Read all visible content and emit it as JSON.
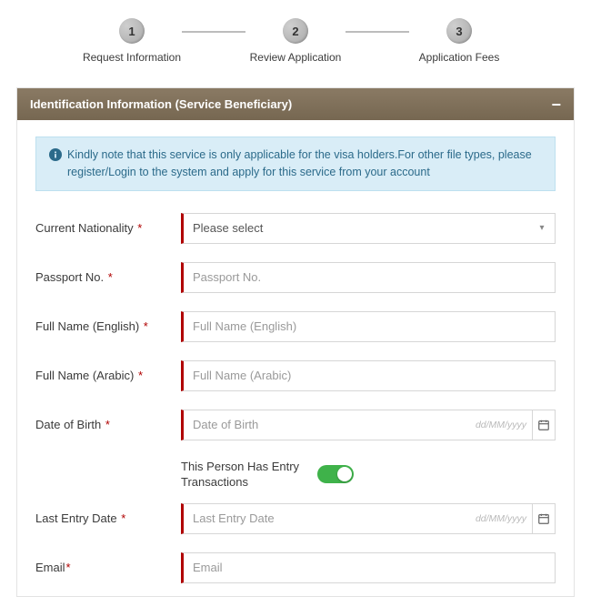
{
  "stepper": {
    "steps": [
      {
        "num": "1",
        "label": "Request Information"
      },
      {
        "num": "2",
        "label": "Review Application"
      },
      {
        "num": "3",
        "label": "Application Fees"
      }
    ]
  },
  "panel": {
    "title": "Identification Information (Service Beneficiary)"
  },
  "alert": {
    "text": "Kindly note that this service is only applicable for the visa holders.For other file types, please register/Login to the system and apply for this service from your account"
  },
  "fields": {
    "nationality": {
      "label": "Current Nationality",
      "value": "Please select"
    },
    "passport": {
      "label": "Passport No.",
      "placeholder": "Passport No."
    },
    "name_en": {
      "label": "Full Name (English)",
      "placeholder": "Full Name (English)"
    },
    "name_ar": {
      "label": "Full Name (Arabic)",
      "placeholder": "Full Name (Arabic)"
    },
    "dob": {
      "label": "Date of Birth",
      "placeholder": "Date of Birth",
      "hint": "dd/MM/yyyy"
    },
    "has_entry": {
      "label": "This Person Has Entry Transactions",
      "value": true
    },
    "last_entry": {
      "label": "Last Entry Date",
      "placeholder": "Last Entry Date",
      "hint": "dd/MM/yyyy"
    },
    "email": {
      "label": "Email",
      "placeholder": "Email"
    }
  },
  "req_marker": " *",
  "req_marker_tight": "*"
}
